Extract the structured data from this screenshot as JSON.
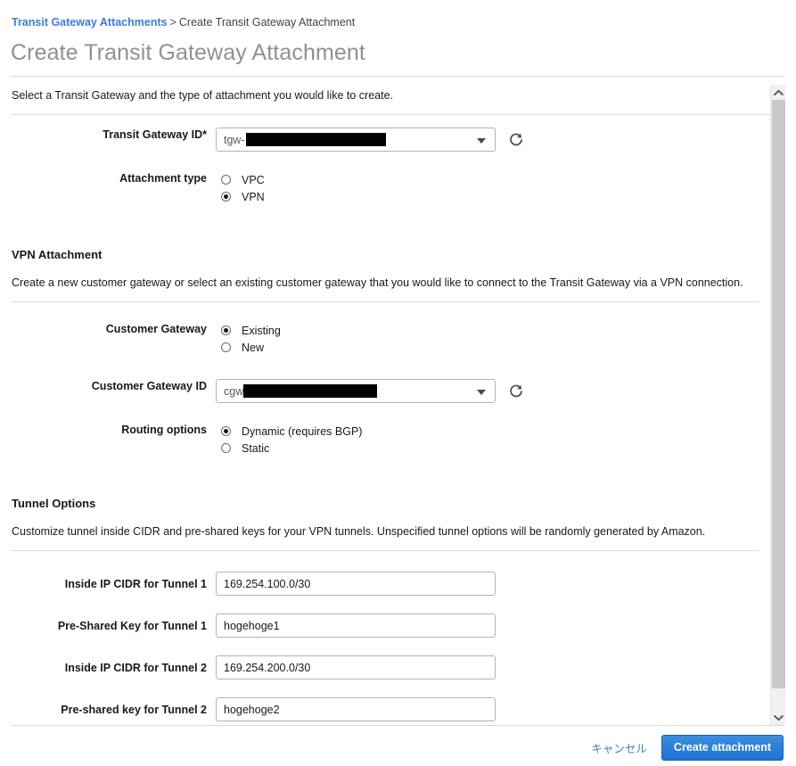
{
  "breadcrumb": {
    "link": "Transit Gateway Attachments",
    "separator": ">",
    "current": "Create Transit Gateway Attachment"
  },
  "page": {
    "title": "Create Transit Gateway Attachment",
    "intro": "Select a Transit Gateway and the type of attachment you would like to create."
  },
  "transit_gateway": {
    "label": "Transit Gateway ID*",
    "value_prefix": "tgw-",
    "value_redacted": true,
    "refresh_icon": "refresh-icon",
    "dropdown_icon": "chevron-down-icon"
  },
  "attachment_type": {
    "label": "Attachment type",
    "options": [
      {
        "label": "VPC",
        "selected": false
      },
      {
        "label": "VPN",
        "selected": true
      }
    ]
  },
  "vpn_attachment": {
    "heading": "VPN Attachment",
    "description": "Create a new customer gateway or select an existing customer gateway that you would like to connect to the Transit Gateway via a VPN connection."
  },
  "customer_gateway": {
    "label": "Customer Gateway",
    "options": [
      {
        "label": "Existing",
        "selected": true
      },
      {
        "label": "New",
        "selected": false
      }
    ]
  },
  "customer_gateway_id": {
    "label": "Customer Gateway ID",
    "value_prefix": "cgw",
    "value_redacted": true,
    "refresh_icon": "refresh-icon",
    "dropdown_icon": "chevron-down-icon"
  },
  "routing_options": {
    "label": "Routing options",
    "options": [
      {
        "label": "Dynamic (requires BGP)",
        "selected": true
      },
      {
        "label": "Static",
        "selected": false
      }
    ]
  },
  "tunnel_options": {
    "heading": "Tunnel Options",
    "description": "Customize tunnel inside CIDR and pre-shared keys for your VPN tunnels. Unspecified tunnel options will be randomly generated by Amazon.",
    "fields": [
      {
        "label": "Inside IP CIDR for Tunnel 1",
        "value": "169.254.100.0/30"
      },
      {
        "label": "Pre-Shared Key for Tunnel 1",
        "value": "hogehoge1"
      },
      {
        "label": "Inside IP CIDR for Tunnel 2",
        "value": "169.254.200.0/30"
      },
      {
        "label": "Pre-shared key for Tunnel 2",
        "value": "hogehoge2"
      }
    ]
  },
  "footer": {
    "cancel_label": "キャンセル",
    "submit_label": "Create attachment"
  },
  "scrollbar": {
    "up_icon": "chevron-up-icon",
    "down_icon": "chevron-down-icon"
  },
  "colors": {
    "link": "#3b7dd8",
    "primary_button": "#1a73d4",
    "title_grey": "#8d9196",
    "border": "#aab7b8"
  }
}
